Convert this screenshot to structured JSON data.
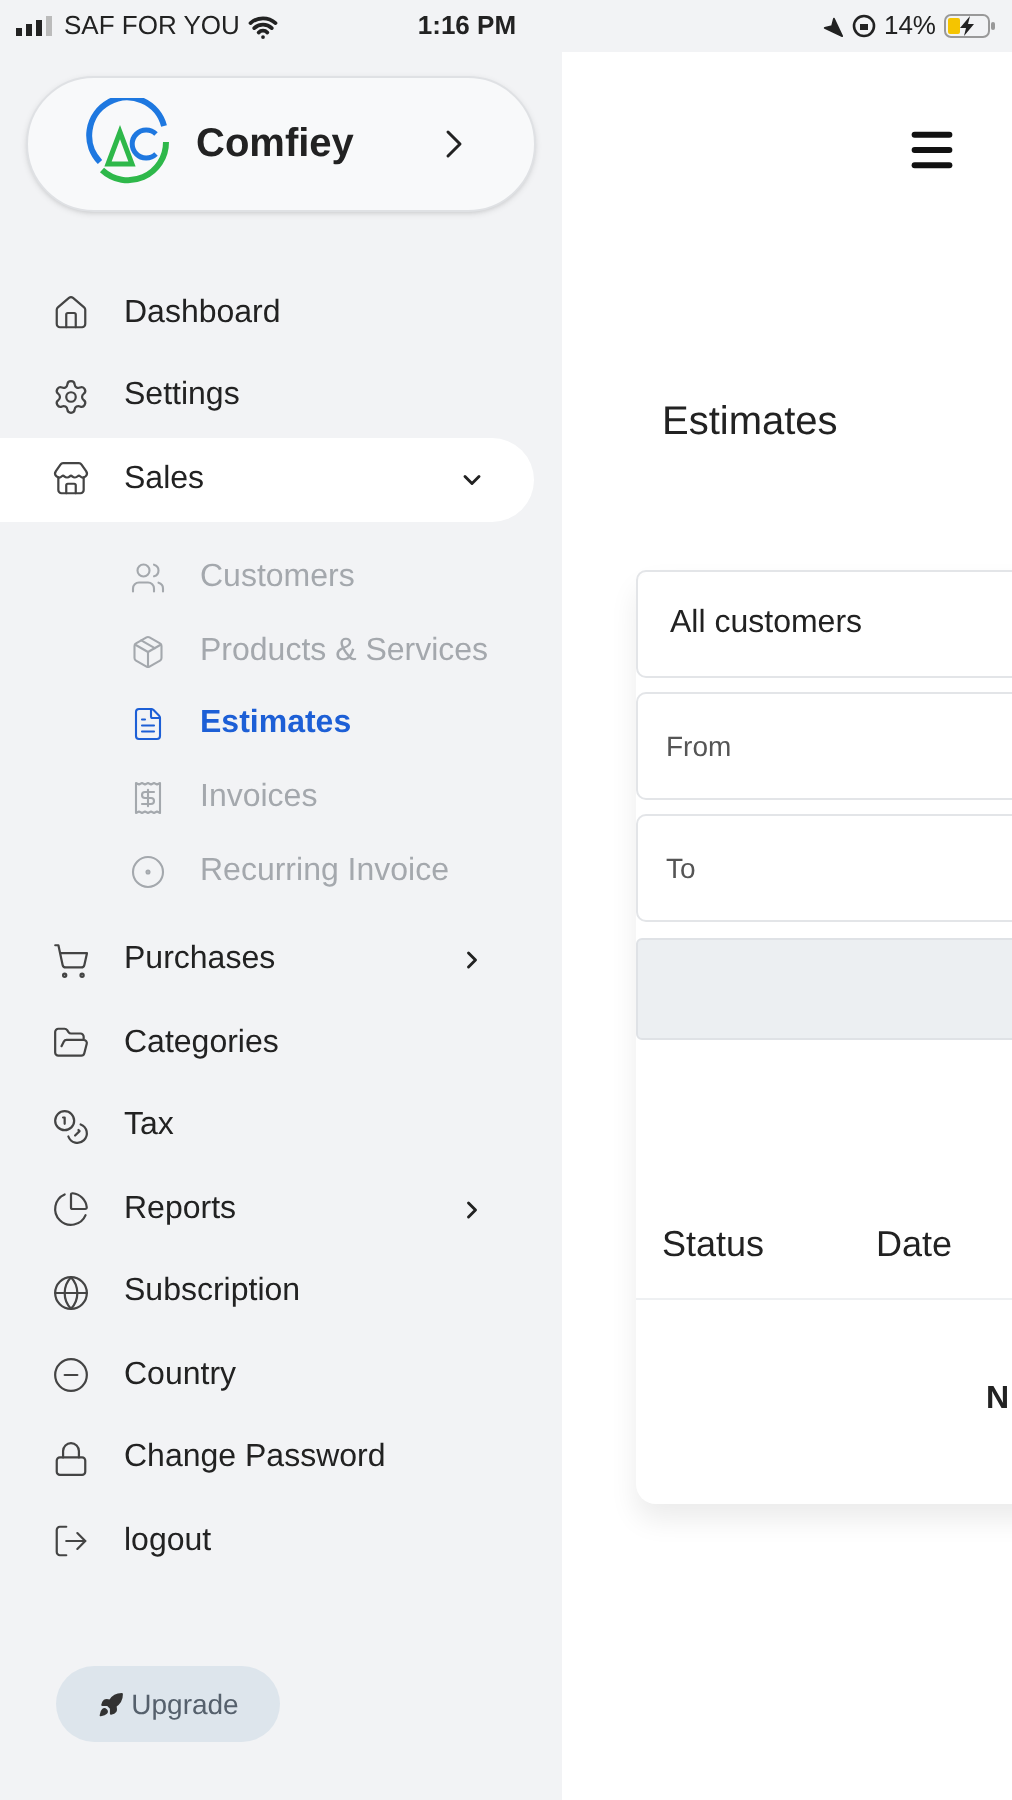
{
  "status_bar": {
    "carrier": "SAF FOR YOU",
    "time": "1:16 PM",
    "battery": "14%"
  },
  "brand": {
    "name": "Comfiey"
  },
  "sidebar": {
    "items": [
      {
        "label": "Dashboard",
        "selected": false
      },
      {
        "label": "Settings",
        "selected": false
      },
      {
        "label": "Sales",
        "selected": true,
        "expanded": true,
        "children": [
          {
            "label": "Customers",
            "selected": false
          },
          {
            "label": "Products & Services",
            "selected": false
          },
          {
            "label": "Estimates",
            "selected": true
          },
          {
            "label": "Invoices",
            "selected": false
          },
          {
            "label": "Recurring Invoice",
            "selected": false
          }
        ]
      },
      {
        "label": "Purchases",
        "selected": false,
        "expanded": false
      },
      {
        "label": "Categories",
        "selected": false
      },
      {
        "label": "Tax",
        "selected": false
      },
      {
        "label": "Reports",
        "selected": false,
        "expanded": false
      },
      {
        "label": "Subscription",
        "selected": false
      },
      {
        "label": "Country",
        "selected": false
      },
      {
        "label": "Change Password",
        "selected": false
      },
      {
        "label": "logout",
        "selected": false
      }
    ]
  },
  "upgrade_button": "Upgrade",
  "page": {
    "title": "Estimates"
  },
  "filters": {
    "customer": "All customers",
    "from": {
      "placeholder": "From"
    },
    "to": {
      "placeholder": "To"
    }
  },
  "table": {
    "columns": [
      "Status",
      "Date"
    ],
    "empty_message": "N"
  }
}
